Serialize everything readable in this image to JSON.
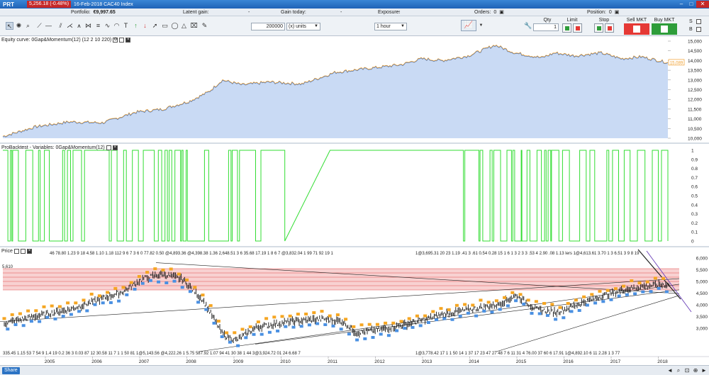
{
  "titlebar": {
    "app_name": "PRT",
    "quote": "5,256.18 (-0.48%)",
    "instrument": "16-Feb-2018 CAC40 Index"
  },
  "infobar": {
    "portfolio_label": "Portfolio:",
    "portfolio_value": "€9,997.65",
    "latent_gain_label": "Latent gain:",
    "latent_gain_value": "-",
    "gain_today_label": "Gain today:",
    "gain_today_value": "-",
    "exposure_label": "Exposure:",
    "exposure_value": "-",
    "orders_label": "Orders:",
    "orders_value": "0",
    "position_label": "Position:",
    "position_value": "0"
  },
  "toolbar": {
    "quantity_value": "200000",
    "units_select": "(x) units",
    "timeframe_select": "1 hour",
    "qty_label": "Qty",
    "qty_value": "1",
    "limit_label": "Limit",
    "stop_label": "Stop",
    "sell_label": "Sell MKT",
    "buy_label": "Buy MKT",
    "side_s": "S",
    "side_b": "B"
  },
  "equity_panel": {
    "title": "Equity curve: 0Gap&Momentum(12) (12 2 10 220)",
    "current_value": "15,089",
    "ylabels": [
      "15,000",
      "14,500",
      "14,000",
      "13,500",
      "13,000",
      "12,500",
      "12,000",
      "11,500",
      "11,000",
      "10,500",
      "10,000"
    ]
  },
  "backtest_panel": {
    "title": "ProBacktest - Variables: 0Gap&Momentum(12)",
    "ylabels": [
      "1",
      "0.9",
      "0.8",
      "0.7",
      "0.6",
      "0.5",
      "0.4",
      "0.3",
      "0.2",
      "0.1",
      "0"
    ]
  },
  "price_panel": {
    "title": "Price",
    "level_label": "5,610",
    "ylabels": [
      "6,000",
      "5,500",
      "5,000",
      "4,500",
      "4,000",
      "3,500",
      "3,000"
    ],
    "top_annotations": "46 78.80 1.23 9 18 4.58 1.10 1.18 112 9 6 7 3 6 0 77.82 0.50 @4,893.36 @4,398.38 1.36 2,648.51 3 6 35.68 17.19 1 8 6 7 @3,832.04 1 99 71 92 19 1",
    "top_annotations_right": "1@3,695.31 20 23 1.19 .41 3 .61 0.54 0.28 15 1 6 1 3 2 3 3 .53 4 2.90 .08 1.13 lers 1@4,613.61 3.70 1 3 6.51 3 9 8 19",
    "bottom_annotations": "335.45 1.15 53 7 54 9 1.4 19 0.2 36 3 0.03 87 12 30.58 11 7 1 1 50 81 1@5,143.56 @4,222.26 1 5.75 587.92 1.07 94 41 30 38 1 44 3@3,924.72 01 24 6.68 7",
    "bottom_annotations_right": "1@3,778.42 17 1 1 50 14 1 37 17 23 47 27 48 7 6 11 31 4 76.00 37 60 6 17.91 1@4,892.10 6 11 2.28 1 3 77",
    "xlabels": [
      "2005",
      "2006",
      "2007",
      "2008",
      "2009",
      "2010",
      "2011",
      "2012",
      "2013",
      "2014",
      "2015",
      "2016",
      "2017",
      "2018"
    ]
  },
  "bottombar": {
    "share_label": "Share"
  },
  "colors": {
    "equity_fill": "#c9daf4",
    "equity_line": "#f0a030",
    "equity_line2": "#4a78c0",
    "backtest_line": "#33dd33",
    "price_band": "#f6c2c2",
    "price_band_line": "#e05050",
    "candles": "#111111",
    "buy_marker": "#4a90e2",
    "sell_marker": "#f5a623",
    "sell_button": "#e53935",
    "buy_button": "#2e9d3a"
  }
}
